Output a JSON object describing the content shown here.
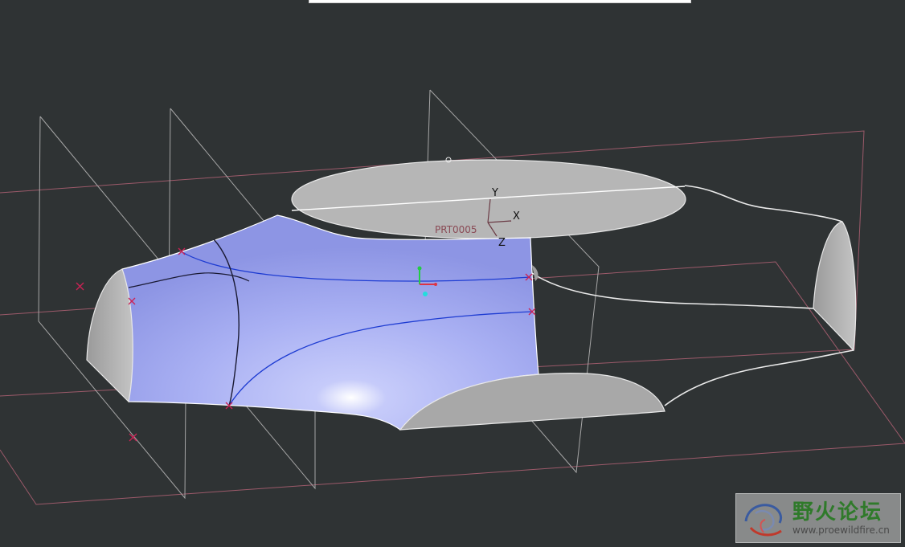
{
  "viewport": {
    "csys_axes": {
      "x": "X",
      "y": "Y",
      "z": "Z"
    },
    "csys_label": "PRT0005"
  },
  "watermark": {
    "logo_icon": "wildfire-swirl-icon",
    "title": "野火论坛",
    "url": "www.proewildfire.cn"
  },
  "colors": {
    "background": "#2f3334",
    "surface": "#a8b0f5",
    "section_face": "#b8b8b8",
    "datum_plane": "#a6a6a6",
    "datum_plane_alt": "#9c5a6a",
    "curve": "#1e3cd2",
    "point_marker": "#cc2255"
  }
}
